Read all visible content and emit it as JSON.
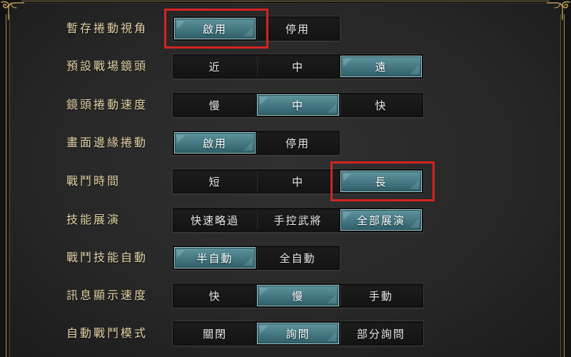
{
  "settings": [
    {
      "label": "暫存捲動視角",
      "options": [
        "啟用",
        "停用"
      ],
      "selected": 0,
      "highlighted_option": 0
    },
    {
      "label": "預設戰場鏡頭",
      "options": [
        "近",
        "中",
        "遠"
      ],
      "selected": 2
    },
    {
      "label": "鏡頭捲動速度",
      "options": [
        "慢",
        "中",
        "快"
      ],
      "selected": 1
    },
    {
      "label": "畫面邊緣捲動",
      "options": [
        "啟用",
        "停用"
      ],
      "selected": 0
    },
    {
      "label": "戰鬥時間",
      "options": [
        "短",
        "中",
        "長"
      ],
      "selected": 2,
      "highlighted_option": 2
    },
    {
      "label": "技能展演",
      "options": [
        "快速略過",
        "手控武將",
        "全部展演"
      ],
      "selected": 2
    },
    {
      "label": "戰鬥技能自動",
      "options": [
        "半自動",
        "全自動"
      ],
      "selected": 0
    },
    {
      "label": "訊息顯示速度",
      "options": [
        "快",
        "慢",
        "手動"
      ],
      "selected": 1
    },
    {
      "label": "自動戰鬥模式",
      "options": [
        "關閉",
        "詢問",
        "部分詢問"
      ],
      "selected": 1
    }
  ],
  "colors": {
    "label_text": "#e6d5aa",
    "option_text": "#ececec",
    "selected_text": "#ffffff",
    "selected_top": "#5e949d",
    "selected_bottom": "#2f5f6a",
    "selected_border": "#a5cdd1",
    "highlight_box": "#d42323",
    "frame_gold": "#b99a58",
    "panel_bg": "#282828"
  }
}
